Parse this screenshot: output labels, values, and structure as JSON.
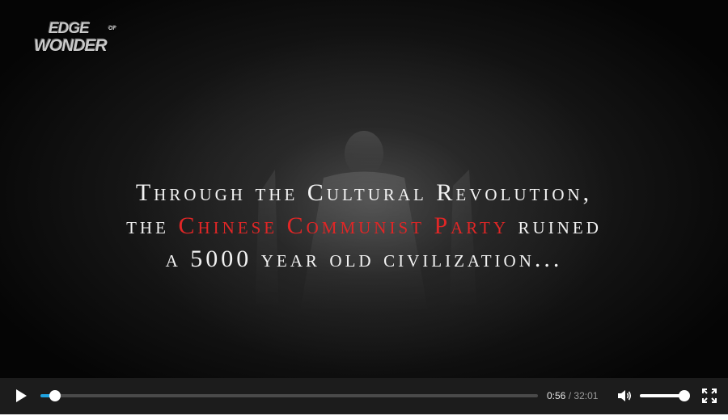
{
  "logo": {
    "line1": "EDGE",
    "of": "OF",
    "line2": "WONDER"
  },
  "headline": {
    "line1": "Through the Cultural Revolution,",
    "line2_pre": "the ",
    "line2_red": "Chinese Communist Party",
    "line2_post": " ruined",
    "line3": "a 5000 year old civilization..."
  },
  "colors": {
    "accent": "#1fa3e0",
    "headline_red": "#e02626",
    "controls_bg": "#1c1c1c"
  },
  "controls": {
    "play_icon": "play-icon",
    "current_time": "0:56",
    "separator": "/",
    "duration": "32:01",
    "progress_fraction": 0.029,
    "volume_icon": "speaker-icon",
    "volume_fraction": 0.95,
    "fullscreen_icon": "fullscreen-icon"
  }
}
